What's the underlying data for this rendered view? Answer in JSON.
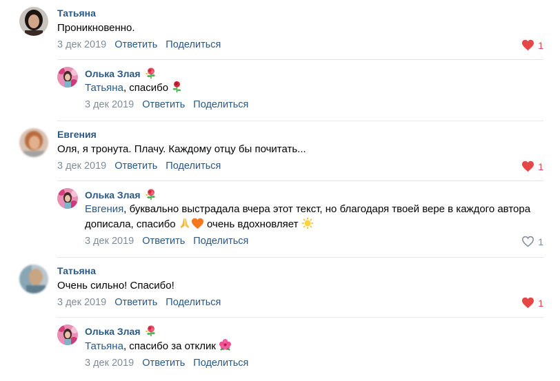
{
  "colors": {
    "link": "#2a5885",
    "meta": "#818c99",
    "liked": "#e64646",
    "divider": "#e7e8ec"
  },
  "actions": {
    "reply": "Ответить",
    "share": "Поделиться"
  },
  "comments": [
    {
      "author": "Татьяна",
      "text": "Проникновенно.",
      "date": "3 дек 2019",
      "likes": "1",
      "liked": true,
      "reply": {
        "author": "Олька Злая",
        "author_emoji": "rose-emoji",
        "mention": "Татьяна",
        "text": ", спасибо",
        "date": "3 дек 2019"
      }
    },
    {
      "author": "Евгения",
      "text": "Оля, я тронута. Плачу. Каждому отцу бы почитать...",
      "date": "3 дек 2019",
      "likes": "1",
      "liked": true,
      "reply": {
        "author": "Олька Злая",
        "author_emoji": "rose-emoji",
        "mention": "Евгения",
        "text_a": ", буквально выстрадала вчера этот текст, но благодаря твоей вере в каждого автора дописала, спасибо",
        "text_b": "очень вдохновляет",
        "date": "3 дек 2019",
        "likes": "1",
        "liked": false
      }
    },
    {
      "author": "Татьяна",
      "text": "Очень сильно! Спасибо!",
      "date": "3 дек 2019",
      "likes": "1",
      "liked": true,
      "reply": {
        "author": "Олька Злая",
        "author_emoji": "rose-emoji",
        "mention": "Татьяна",
        "text": ", спасибо за отклик",
        "date": "3 дек 2019"
      }
    }
  ]
}
